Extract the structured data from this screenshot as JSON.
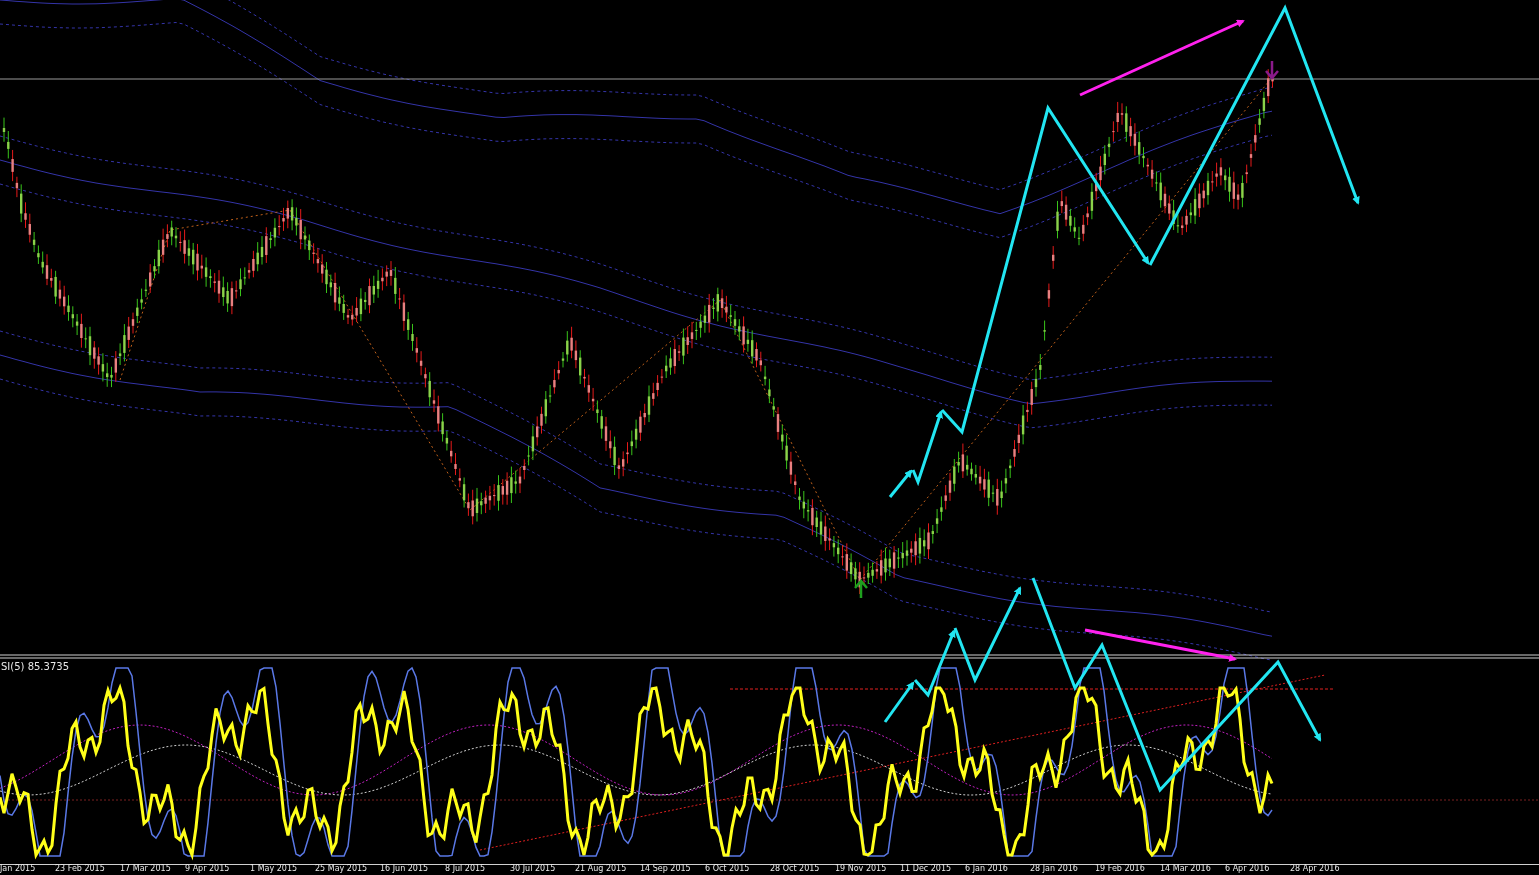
{
  "indicator": {
    "label": "SI(5) 85.3735"
  },
  "time_axis": {
    "labels": [
      "Jan 2015",
      "23 Feb 2015",
      "17 Mar 2015",
      "9 Apr 2015",
      "1 May 2015",
      "25 May 2015",
      "16 Jun 2015",
      "8 Jul 2015",
      "30 Jul 2015",
      "21 Aug 2015",
      "14 Sep 2015",
      "6 Oct 2015",
      "28 Oct 2015",
      "19 Nov 2015",
      "11 Dec 2015",
      "6 Jan 2016",
      "28 Jan 2016",
      "19 Feb 2016",
      "14 Mar 2016",
      "6 Apr 2016",
      "28 Apr 2016"
    ]
  }
}
